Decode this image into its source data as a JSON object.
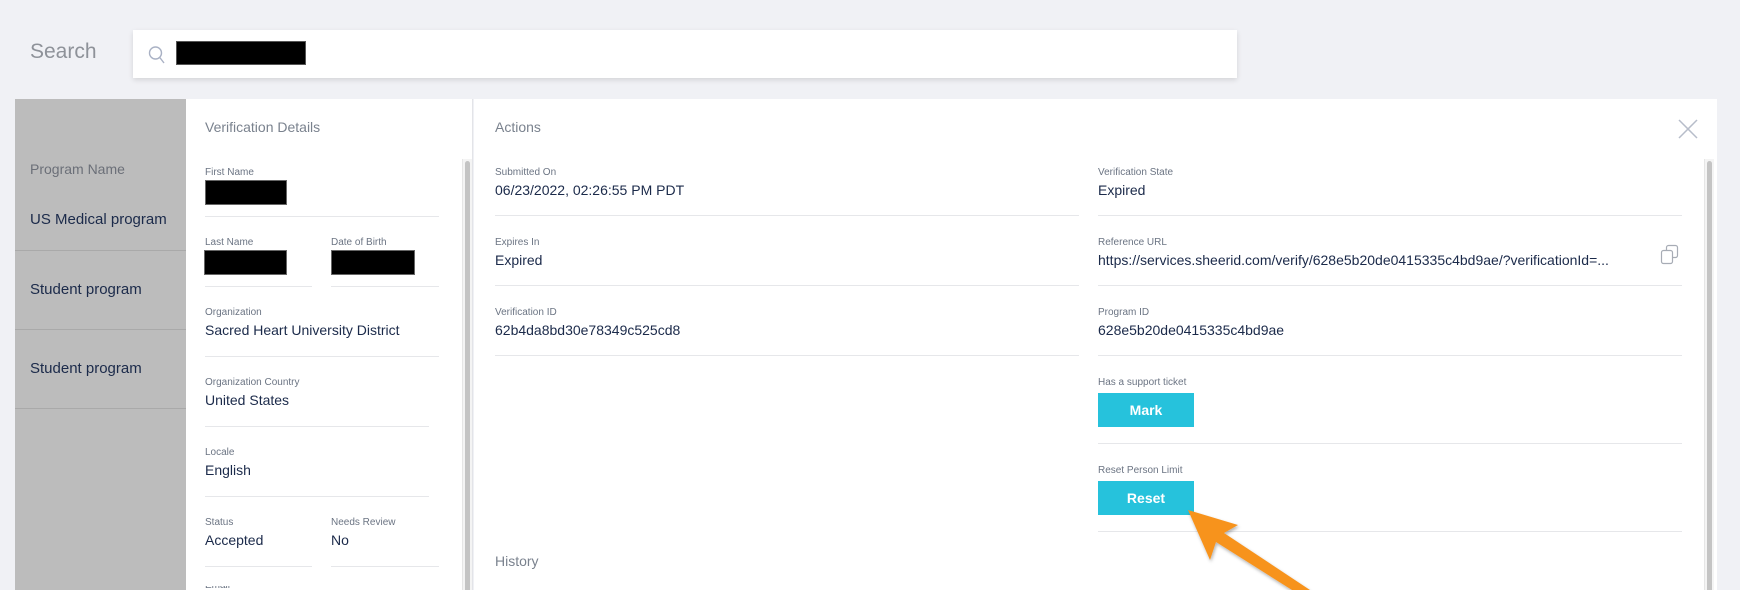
{
  "search": {
    "label": "Search",
    "value_redacted": true
  },
  "program_list": {
    "header": "Program Name",
    "items": [
      {
        "label": "US Medical program"
      },
      {
        "label": "Student program"
      },
      {
        "label": "Student program"
      }
    ]
  },
  "verification_details": {
    "title": "Verification Details",
    "first_name": {
      "label": "First Name"
    },
    "last_name": {
      "label": "Last Name"
    },
    "date_of_birth": {
      "label": "Date of Birth"
    },
    "organization": {
      "label": "Organization",
      "value": "Sacred Heart University District"
    },
    "organization_country": {
      "label": "Organization Country",
      "value": "United States"
    },
    "locale": {
      "label": "Locale",
      "value": "English"
    },
    "status": {
      "label": "Status",
      "value": "Accepted"
    },
    "needs_review": {
      "label": "Needs Review",
      "value": "No"
    },
    "email": {
      "label": "Email"
    }
  },
  "actions": {
    "title": "Actions",
    "submitted_on": {
      "label": "Submitted On",
      "value": "06/23/2022, 02:26:55 PM PDT"
    },
    "expires_in": {
      "label": "Expires In",
      "value": "Expired"
    },
    "verification_id": {
      "label": "Verification ID",
      "value": "62b4da8bd30e78349c525cd8"
    },
    "verification_state": {
      "label": "Verification State",
      "value": "Expired"
    },
    "reference_url": {
      "label": "Reference URL",
      "value": "https://services.sheerid.com/verify/628e5b20de0415335c4bd9ae/?verificationId=..."
    },
    "program_id": {
      "label": "Program ID",
      "value": "628e5b20de0415335c4bd9ae"
    },
    "support_ticket": {
      "label": "Has a support ticket",
      "button": "Mark"
    },
    "reset_person_limit": {
      "label": "Reset Person Limit",
      "button": "Reset"
    },
    "history_title": "History"
  },
  "colors": {
    "accent_button": "#26c2dc",
    "annotation_arrow": "#f7931e",
    "program_list_bg": "#bcbcbc",
    "page_bg": "#f0f1f5"
  }
}
